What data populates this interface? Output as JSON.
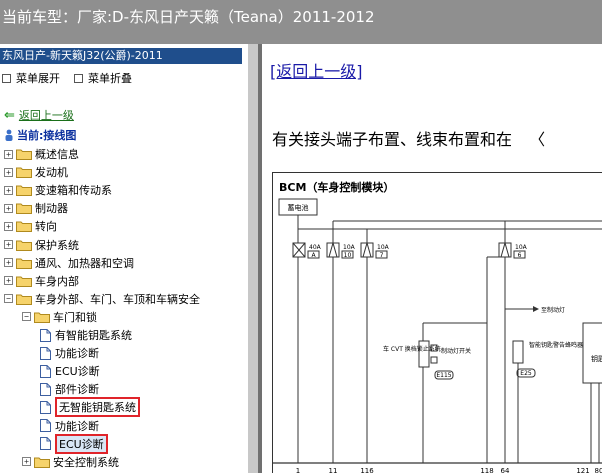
{
  "window": {
    "title": "当前车型：厂家:D-东风日产天籁（Teana）2011-2012"
  },
  "left_panel": {
    "header": "东风日产-新天籁J32(公爵)-2011",
    "expand_all": "菜单展开",
    "collapse_all": "菜单折叠",
    "back": "返回上一级",
    "current": "当前:接线图",
    "tree": [
      {
        "label": "概述信息",
        "level": 0,
        "type": "folder",
        "expander": "+"
      },
      {
        "label": "发动机",
        "level": 0,
        "type": "folder",
        "expander": "+"
      },
      {
        "label": "变速箱和传动系",
        "level": 0,
        "type": "folder",
        "expander": "+"
      },
      {
        "label": "制动器",
        "level": 0,
        "type": "folder",
        "expander": "+"
      },
      {
        "label": "转向",
        "level": 0,
        "type": "folder",
        "expander": "+"
      },
      {
        "label": "保护系统",
        "level": 0,
        "type": "folder",
        "expander": "+"
      },
      {
        "label": "通风、加热器和空调",
        "level": 0,
        "type": "folder",
        "expander": "+"
      },
      {
        "label": "车身内部",
        "level": 0,
        "type": "folder",
        "expander": "+"
      },
      {
        "label": "车身外部、车门、车顶和车辆安全",
        "level": 0,
        "type": "folder",
        "expander": "−"
      },
      {
        "label": "车门和锁",
        "level": 1,
        "type": "folder",
        "expander": "−"
      },
      {
        "label": "有智能钥匙系统",
        "level": 2,
        "type": "doc"
      },
      {
        "label": "功能诊断",
        "level": 2,
        "type": "doc"
      },
      {
        "label": "ECU诊断",
        "level": 2,
        "type": "doc"
      },
      {
        "label": "部件诊断",
        "level": 2,
        "type": "doc"
      },
      {
        "label": "无智能钥匙系统",
        "level": 2,
        "type": "doc",
        "highlight": true
      },
      {
        "label": "功能诊断",
        "level": 2,
        "type": "doc"
      },
      {
        "label": "ECU诊断",
        "level": 2,
        "type": "doc",
        "highlight": true,
        "selected": true
      },
      {
        "label": "安全控制系统",
        "level": 1,
        "type": "folder",
        "expander": "+"
      }
    ]
  },
  "right_panel": {
    "back_link": "[返回上一级]",
    "description": "有关接头端子布置、线束布置和在",
    "diagram": {
      "title": "BCM（车身控制模块）",
      "battery": "蓄电池",
      "fuses": [
        {
          "amp": "40A",
          "num": "A"
        },
        {
          "amp": "10A",
          "num": "10"
        },
        {
          "amp": "10A",
          "num": "7"
        },
        {
          "amp": "10A",
          "num": "6"
        }
      ],
      "to_brake_light": "至制动灯",
      "cvt_lock_label": "车 CVT 换档锁止系统",
      "brake_switch_label": "制动灯开关",
      "brake_switch_code": "E115",
      "smart_key_label": "智能钥匙警告蜂鸣器",
      "smart_key_code": "E25",
      "right_partial": "钥匙",
      "pins": [
        "1",
        "11",
        "116",
        "118",
        "64",
        "121",
        "80"
      ]
    }
  },
  "colors": {
    "titlebar_bg": "#8f8f8f",
    "left_header_bg": "#1f4e8c",
    "highlight_border": "#e0242a",
    "link_blue": "#1a1aa8"
  }
}
